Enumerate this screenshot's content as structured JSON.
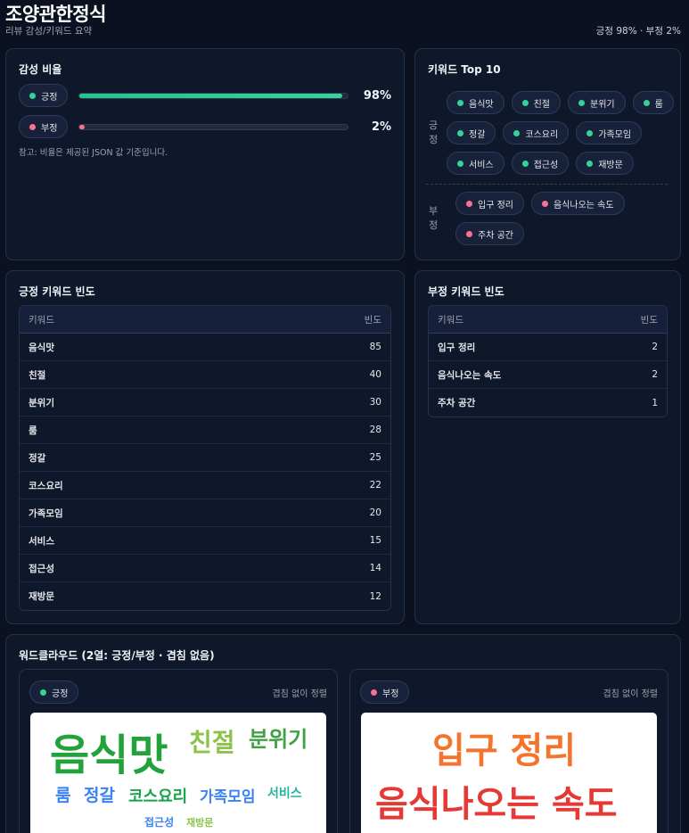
{
  "header": {
    "title": "조양관한정식",
    "subtitle": "리뷰 감성/키워드 요약",
    "summary": "긍정 98% · 부정 2%"
  },
  "sentiment": {
    "title": "감성 비율",
    "positive": {
      "label": "긍정",
      "value": 98,
      "value_text": "98%"
    },
    "negative": {
      "label": "부정",
      "value": 2,
      "value_text": "2%"
    },
    "note": "참고: 비율은 제공된 JSON 값 기준입니다."
  },
  "keywords_top": {
    "title": "키워드 Top 10",
    "positive_label": "긍정",
    "negative_label": "부정",
    "positive": [
      "음식맛",
      "친절",
      "분위기",
      "룸",
      "정갈",
      "코스요리",
      "가족모임",
      "서비스",
      "접근성",
      "재방문"
    ],
    "negative": [
      "입구 정리",
      "음식나오는 속도",
      "주차 공간"
    ]
  },
  "pos_freq": {
    "title": "긍정 키워드 빈도",
    "col_keyword": "키워드",
    "col_count": "빈도",
    "rows": [
      {
        "k": "음식맛",
        "v": "85"
      },
      {
        "k": "친절",
        "v": "40"
      },
      {
        "k": "분위기",
        "v": "30"
      },
      {
        "k": "룸",
        "v": "28"
      },
      {
        "k": "정갈",
        "v": "25"
      },
      {
        "k": "코스요리",
        "v": "22"
      },
      {
        "k": "가족모임",
        "v": "20"
      },
      {
        "k": "서비스",
        "v": "15"
      },
      {
        "k": "접근성",
        "v": "14"
      },
      {
        "k": "재방문",
        "v": "12"
      }
    ]
  },
  "neg_freq": {
    "title": "부정 키워드 빈도",
    "col_keyword": "키워드",
    "col_count": "빈도",
    "rows": [
      {
        "k": "입구 정리",
        "v": "2"
      },
      {
        "k": "음식나오는 속도",
        "v": "2"
      },
      {
        "k": "주차 공간",
        "v": "1"
      }
    ]
  },
  "wordcloud": {
    "title": "워드클라우드 (2열: 긍정/부정 · 겹침 없음)",
    "positive_label": "긍정",
    "negative_label": "부정",
    "note": "겹침 없이 정렬",
    "positive_words": [
      {
        "text": "음식맛",
        "color": "#22a33a"
      },
      {
        "text": "친절",
        "color": "#8bc34a"
      },
      {
        "text": "분위기",
        "color": "#43a047"
      },
      {
        "text": "룸",
        "color": "#3b82f6"
      },
      {
        "text": "정갈",
        "color": "#3b82f6"
      },
      {
        "text": "코스요리",
        "color": "#16a34a"
      },
      {
        "text": "가족모임",
        "color": "#3b82f6"
      },
      {
        "text": "서비스",
        "color": "#22b5a0"
      },
      {
        "text": "접근성",
        "color": "#3b82f6"
      },
      {
        "text": "재방문",
        "color": "#8bc34a"
      }
    ],
    "negative_words": [
      {
        "text": "입구 정리",
        "color": "#f5732a"
      },
      {
        "text": "음식나오는 속도",
        "color": "#e53935"
      }
    ]
  },
  "colors": {
    "positive": "#34d399",
    "negative": "#f87191",
    "positive_bar": "#34d399"
  }
}
